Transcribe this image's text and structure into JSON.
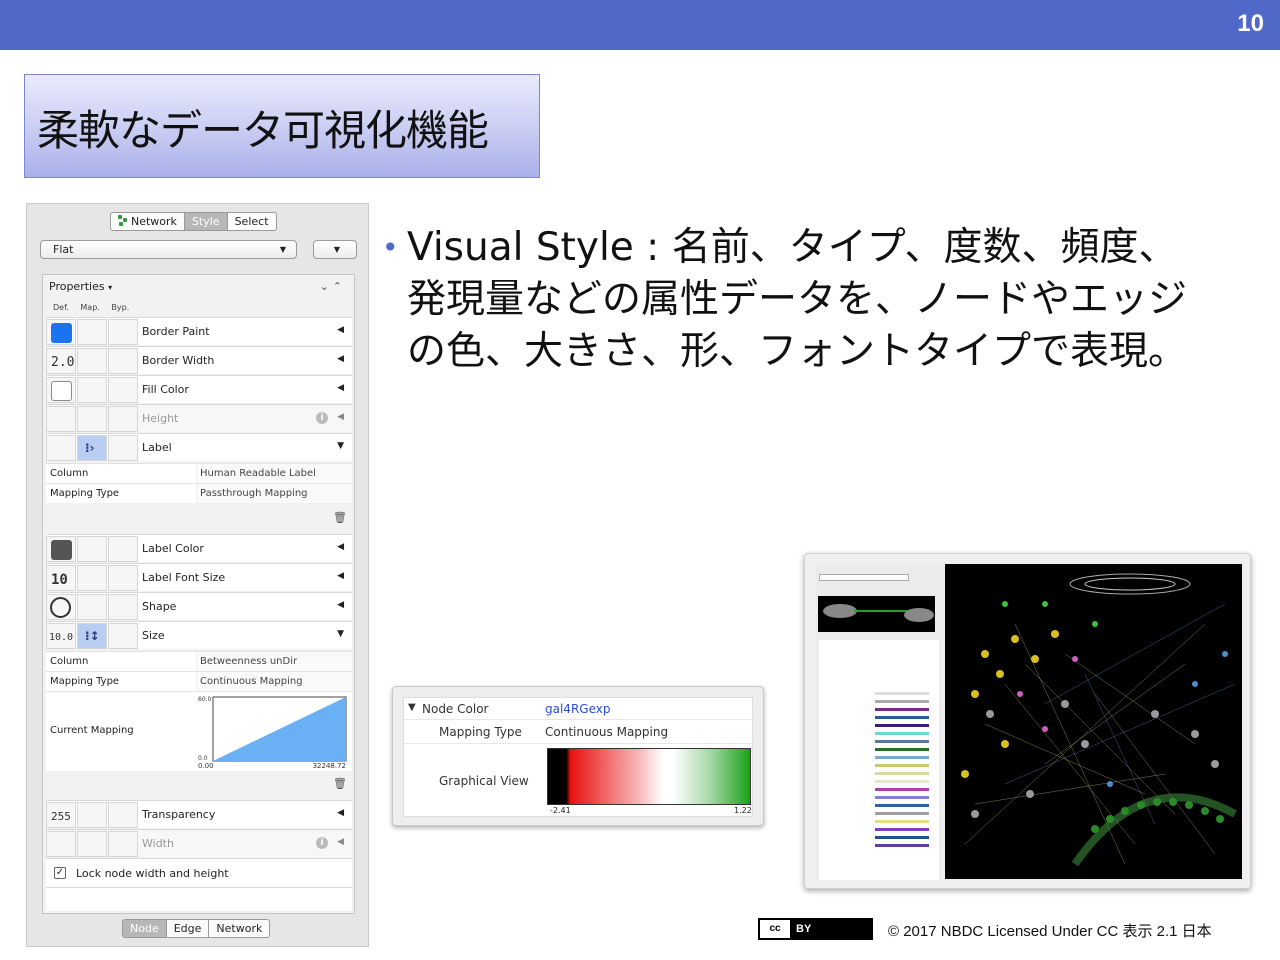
{
  "slide": {
    "number": "10",
    "title": "柔軟なデータ可視化機能"
  },
  "panel": {
    "tabs": [
      "Network",
      "Style",
      "Select"
    ],
    "active_tab": "Style",
    "style_select": "Flat",
    "properties_label": "Properties",
    "col_headers": [
      "Def.",
      "Map.",
      "Byp."
    ],
    "border_paint": {
      "label": "Border Paint",
      "color": "#1a73f0"
    },
    "border_width": {
      "label": "Border Width",
      "value": "2.0"
    },
    "fill_color": {
      "label": "Fill Color",
      "color": "#ffffff"
    },
    "height": {
      "label": "Height"
    },
    "label": {
      "label": "Label",
      "column_key": "Column",
      "column_value": "Human Readable Label",
      "mapping_key": "Mapping Type",
      "mapping_value": "Passthrough Mapping"
    },
    "label_color": {
      "label": "Label Color",
      "color": "#555555"
    },
    "label_font_size": {
      "label": "Label Font Size",
      "value": "10"
    },
    "shape": {
      "label": "Shape"
    },
    "size": {
      "label": "Size",
      "value": "10.0",
      "column_key": "Column",
      "column_value": "Betweenness unDir",
      "mapping_key": "Mapping Type",
      "mapping_value": "Continuous Mapping",
      "current_key": "Current Mapping",
      "y_max": "60.0",
      "y_min": "0.0",
      "x_min": "0.00",
      "x_max": "32248.72"
    },
    "transparency": {
      "label": "Transparency",
      "value": "255"
    },
    "width": {
      "label": "Width"
    },
    "lock_label": "Lock node width and height",
    "bottom_tabs": [
      "Node",
      "Edge",
      "Network"
    ],
    "bottom_active": "Node"
  },
  "bullet": {
    "lines": [
      "Visual Style : 名前、タイプ、度数、頻度、",
      "発現量などの属性データを、ノードやエッジ",
      "の色、大きさ、形、フォントタイプで表現。"
    ]
  },
  "node_color": {
    "title": "Node Color",
    "column": "gal4RGexp",
    "mapping_key": "Mapping Type",
    "mapping_value": "Continuous Mapping",
    "view_key": "Graphical View",
    "min": "-2.41",
    "max": "1.22"
  },
  "footer": {
    "cc_left": "cc",
    "cc_right": "BY",
    "license": "© 2017  NBDC Licensed Under CC 表示 2.1 日本"
  }
}
